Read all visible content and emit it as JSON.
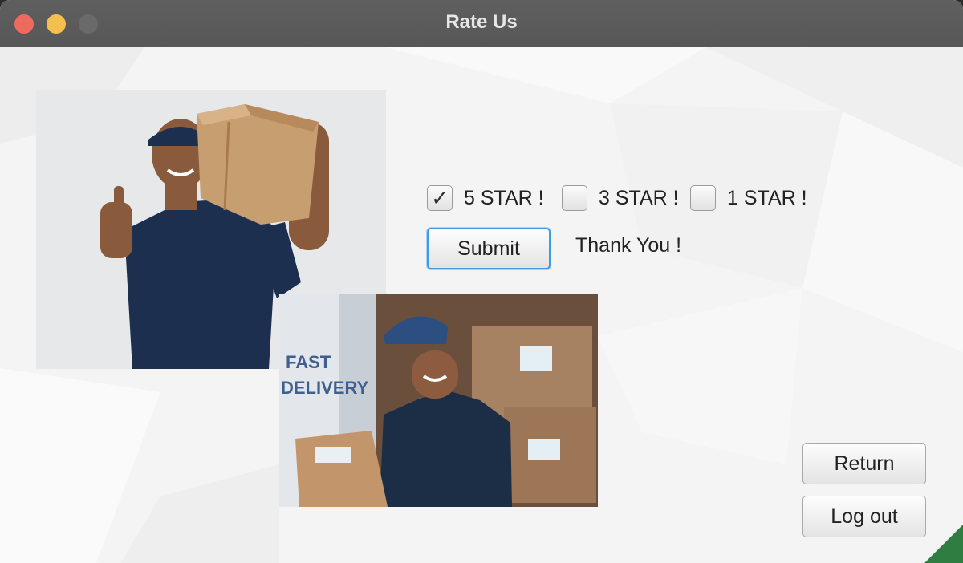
{
  "window": {
    "title": "Rate Us"
  },
  "ratings": [
    {
      "label": "5 STAR !",
      "checked": true
    },
    {
      "label": "3 STAR !",
      "checked": false
    },
    {
      "label": "1 STAR !",
      "checked": false
    }
  ],
  "submit_label": "Submit",
  "message": "Thank You !",
  "return_label": "Return",
  "logout_label": "Log out",
  "icons": {
    "checkmark": "✓"
  }
}
